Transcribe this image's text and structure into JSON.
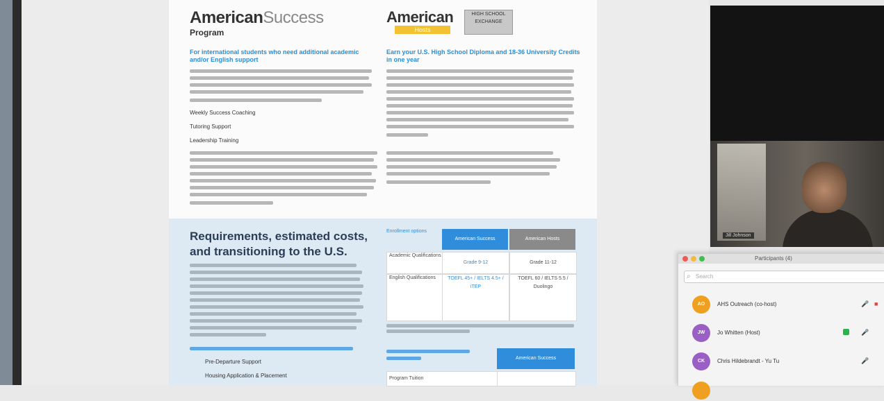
{
  "document": {
    "logo_left": "American",
    "logo_left_light": "Success",
    "logo_left_sub": "Program",
    "logo_right": "American",
    "logo_right_sub": "Hosts",
    "badge": "HIGH SCHOOL EXCHANGE",
    "left_heading": "For international students who need additional academic and/or English support",
    "right_heading": "Earn your U.S. High School Diploma and 18-36 University Credits in one year",
    "bullets": [
      "Weekly Success Coaching",
      "Tutoring Support",
      "Leadership Training"
    ],
    "requirements_title": "Requirements, estimated costs, and transitioning to the U.S.",
    "table_headers": [
      "Enrollment options",
      "American Success",
      "American Hosts"
    ],
    "table_rows": [
      {
        "label": "Academic Qualifications",
        "c1": "Grade 9-12",
        "c2": "Grade 11-12"
      },
      {
        "label": "English Qualifications",
        "c1": "TOEFL 45+ / IELTS 4.5+ / iTEP",
        "c2": "TOEFL 60 / IELTS 5.5 / Duolingo"
      }
    ],
    "sub_links": [
      "Pre-Departure Support",
      "Housing Application & Placement"
    ],
    "second_table_header": "American Success",
    "second_table_label": "Program Tuition"
  },
  "video": {
    "participant_name": "Jill Johnson"
  },
  "participants_window": {
    "title": "Participants (4)",
    "search_placeholder": "Search",
    "rows": [
      {
        "initials": "AO",
        "name": "AHS Outreach (co-host)",
        "color": "#f0a020"
      },
      {
        "initials": "JW",
        "name": "Jo Whitten (Host)",
        "color": "#9a5fc4"
      },
      {
        "initials": "CK",
        "name": "Chris Hildebrandt - Yu Tu",
        "color": "#9a5fc4"
      }
    ]
  }
}
